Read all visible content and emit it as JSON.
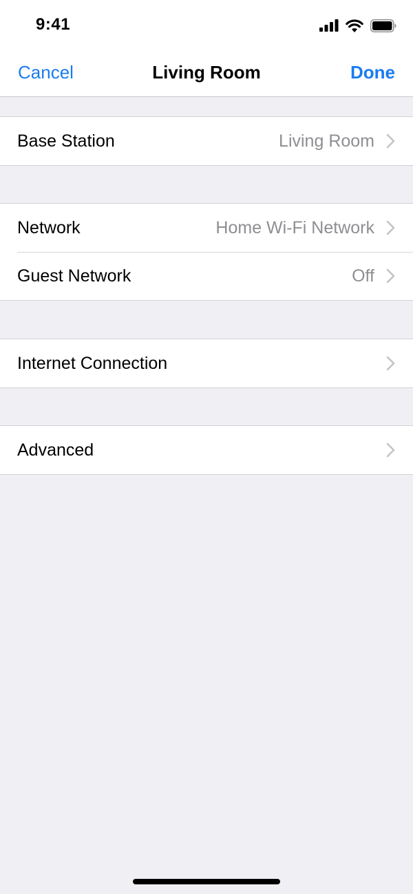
{
  "status_bar": {
    "time": "9:41",
    "icons": [
      "cellular-signal-icon",
      "wifi-icon",
      "battery-icon"
    ]
  },
  "nav": {
    "cancel_label": "Cancel",
    "title": "Living Room",
    "done_label": "Done"
  },
  "sections": {
    "base_station": {
      "label": "Base Station",
      "value": "Living Room"
    },
    "network": {
      "label": "Network",
      "value": "Home Wi-Fi Network"
    },
    "guest_network": {
      "label": "Guest Network",
      "value": "Off"
    },
    "internet_connection": {
      "label": "Internet Connection",
      "value": ""
    },
    "advanced": {
      "label": "Advanced",
      "value": ""
    }
  },
  "colors": {
    "accent": "#1a7cf0",
    "background": "#efeff4",
    "secondary_text": "#8e8e93",
    "chevron": "#c4c4c7"
  },
  "icons": {
    "row_accessory": "chevron-right-icon"
  }
}
